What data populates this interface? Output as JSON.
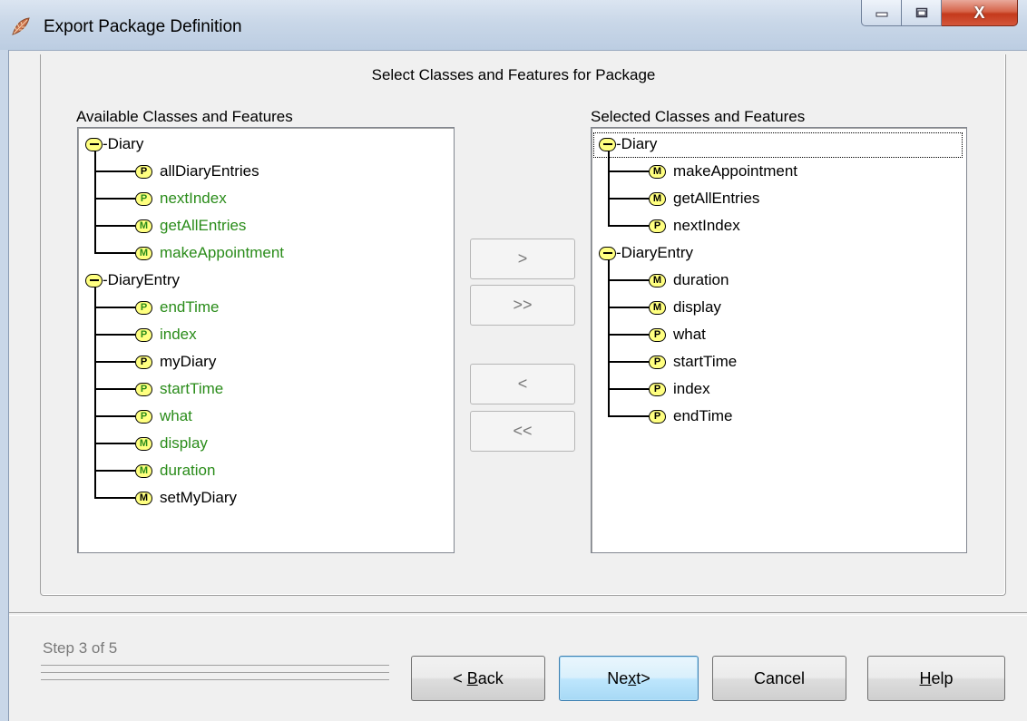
{
  "window": {
    "title": "Export Package Definition",
    "minimize": "minimize",
    "maximize": "maximize",
    "close": "X"
  },
  "group": {
    "caption": "Select Classes and Features for Package"
  },
  "available": {
    "label": "Available Classes and Features",
    "classes": [
      {
        "name": "Diary",
        "text": "-Diary",
        "features": [
          {
            "badge": "P",
            "name": "allDiaryEntries",
            "green": false
          },
          {
            "badge": "P",
            "name": "nextIndex",
            "green": true
          },
          {
            "badge": "M",
            "name": "getAllEntries",
            "green": true
          },
          {
            "badge": "M",
            "name": "makeAppointment",
            "green": true
          }
        ]
      },
      {
        "name": "DiaryEntry",
        "text": "-DiaryEntry",
        "features": [
          {
            "badge": "P",
            "name": "endTime",
            "green": true
          },
          {
            "badge": "P",
            "name": "index",
            "green": true
          },
          {
            "badge": "P",
            "name": "myDiary",
            "green": false
          },
          {
            "badge": "P",
            "name": "startTime",
            "green": true
          },
          {
            "badge": "P",
            "name": "what",
            "green": true
          },
          {
            "badge": "M",
            "name": "display",
            "green": true
          },
          {
            "badge": "M",
            "name": "duration",
            "green": true
          },
          {
            "badge": "M",
            "name": "setMyDiary",
            "green": false
          }
        ]
      }
    ]
  },
  "selected": {
    "label": "Selected Classes and Features",
    "classes": [
      {
        "name": "Diary",
        "text": "-Diary",
        "focused": true,
        "features": [
          {
            "badge": "M",
            "name": "makeAppointment",
            "green": false
          },
          {
            "badge": "M",
            "name": "getAllEntries",
            "green": false
          },
          {
            "badge": "P",
            "name": "nextIndex",
            "green": false
          }
        ]
      },
      {
        "name": "DiaryEntry",
        "text": "-DiaryEntry",
        "features": [
          {
            "badge": "M",
            "name": "duration",
            "green": false
          },
          {
            "badge": "M",
            "name": "display",
            "green": false
          },
          {
            "badge": "P",
            "name": "what",
            "green": false
          },
          {
            "badge": "P",
            "name": "startTime",
            "green": false
          },
          {
            "badge": "P",
            "name": "index",
            "green": false
          },
          {
            "badge": "P",
            "name": "endTime",
            "green": false
          }
        ]
      }
    ]
  },
  "move_buttons": {
    "add": ">",
    "add_all": ">>",
    "remove": "<",
    "remove_all": "<<"
  },
  "footer": {
    "step": "Step 3 of 5",
    "back": "< Back",
    "next": "Next>",
    "cancel": "Cancel",
    "help": "Help"
  },
  "colors": {
    "feature_green": "#2a8c1a",
    "badge_fill": "#ffff80"
  }
}
